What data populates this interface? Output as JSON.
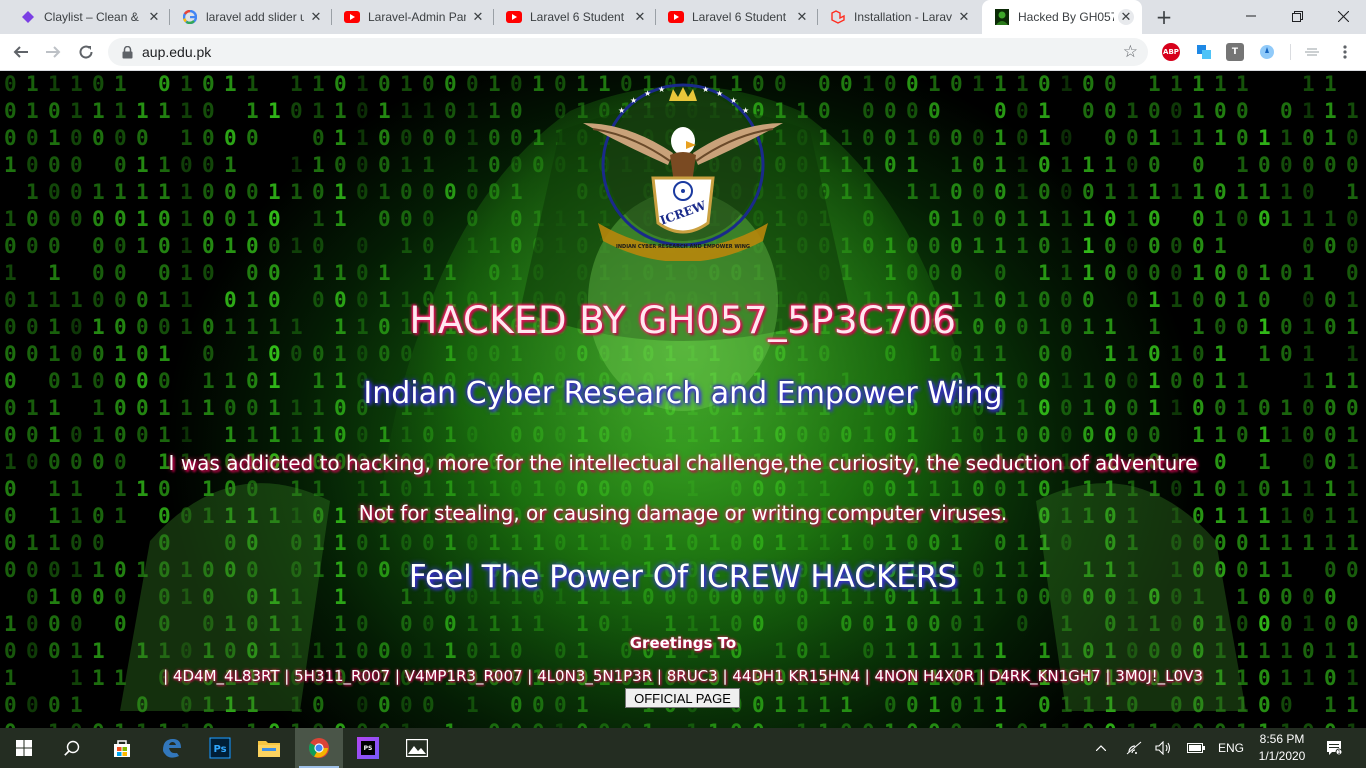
{
  "browser": {
    "tabs": [
      {
        "title": "Claylist – Clean & ",
        "icon": "claylist-icon",
        "color": "#7b3fe4"
      },
      {
        "title": "laravel add slider u",
        "icon": "google-icon",
        "color": "#4285f4"
      },
      {
        "title": "Laravel-Admin Pan",
        "icon": "youtube-icon",
        "color": "#ff0000"
      },
      {
        "title": "Laravel 6 Student I",
        "icon": "youtube-icon",
        "color": "#ff0000"
      },
      {
        "title": "Laravel 6 Student I",
        "icon": "youtube-icon",
        "color": "#ff0000"
      },
      {
        "title": "Installation - Larav",
        "icon": "laravel-icon",
        "color": "#ff2d20"
      },
      {
        "title": "Hacked By GH057_",
        "icon": "hacker-favicon",
        "color": "#2a7a1a",
        "active": true
      }
    ],
    "url": "aup.edu.pk",
    "extensions": {
      "abp": "ABP",
      "t": "T"
    }
  },
  "page": {
    "title": "HACKED BY GH057_5P3C706",
    "org": "Indian Cyber Research and Empower Wing",
    "quote1": "I was addicted to hacking, more for the intellectual challenge,the curiosity, the seduction of adventure",
    "quote2": "Not for stealing, or causing damage or writing computer viruses.",
    "slogan": "Feel The Power Of ICREW HACKERS",
    "greetings_label": "Greetings To",
    "greetings": "| 4D4M_4L83RT | 5H311_R007 | V4MP1R3_R007 | 4L0N3_5N1P3R | 8RUC3 | 44DH1 KR15HN4 | 4NON H4X0R | D4RK_KN1GH7 | 3M0J!_L0V3",
    "official_button": "OFFICIAL PAGE",
    "logo_text": "ICREW",
    "logo_ribbon": "INDIAN CYBER RESEARCH AND EMPOWER WING",
    "colors": {
      "matrix": "#38d21c",
      "title_glow": "#ff2a6d",
      "subtitle_glow": "#3a2bd8"
    }
  },
  "taskbar": {
    "language": "ENG",
    "time": "8:56 PM",
    "date": "1/1/2020",
    "photoshop_label": "Ps",
    "phpstorm_label": "PS"
  }
}
